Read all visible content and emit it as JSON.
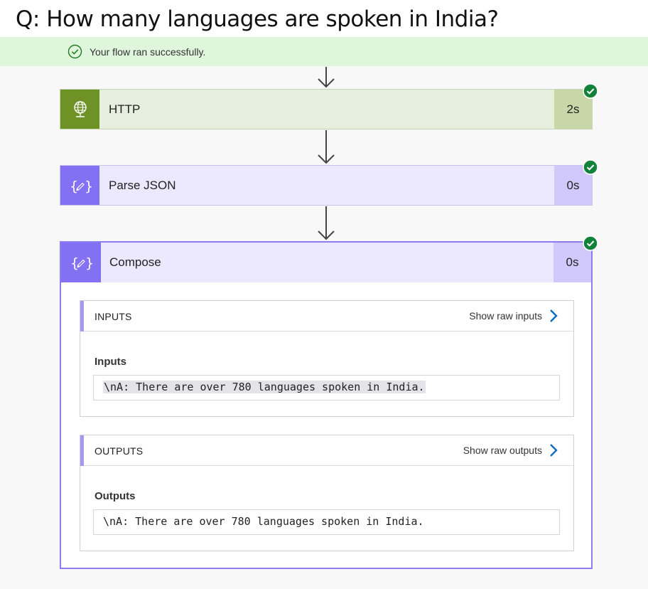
{
  "question": "Q: How many languages are spoken in India?",
  "banner": {
    "message": "Your flow ran successfully."
  },
  "steps": [
    {
      "name": "HTTP",
      "duration": "2s",
      "icon": "globe-icon",
      "color": "#6f9226"
    },
    {
      "name": "Parse JSON",
      "duration": "0s",
      "icon": "braces-icon",
      "color": "#8370f2"
    }
  ],
  "compose": {
    "name": "Compose",
    "duration": "0s",
    "icon": "braces-icon",
    "inputs": {
      "title": "INPUTS",
      "raw_label": "Show raw inputs",
      "field_label": "Inputs",
      "value": "\\nA: There are over 780 languages spoken in India."
    },
    "outputs": {
      "title": "OUTPUTS",
      "raw_label": "Show raw outputs",
      "field_label": "Outputs",
      "value": "\\nA: There are over 780 languages spoken in India."
    }
  },
  "colors": {
    "success": "#107c10",
    "accent": "#8370f2",
    "http": "#6f9226",
    "link": "#0f6cbd"
  }
}
